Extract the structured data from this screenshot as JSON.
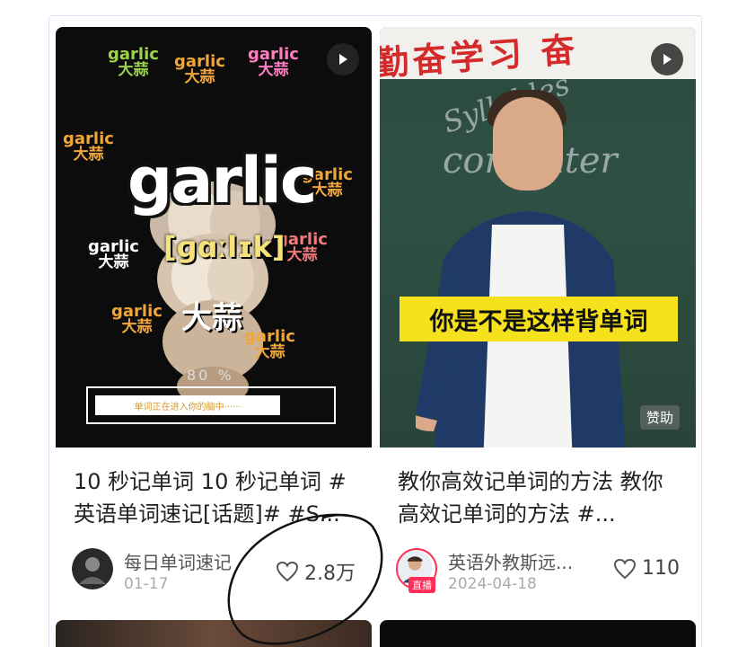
{
  "cards": [
    {
      "title": "10 秒记单词 10 秒记单词 #英语单词速记[话题]# #S...",
      "author": "每日单词速记",
      "date": "01-17",
      "likes": "2.8万",
      "thumb": {
        "word": "garlic",
        "phonetic": "[ɡɑːlɪk]",
        "meaning": "大蒜",
        "small_en": "garlic",
        "small_cn": "大蒜",
        "progress_text": "80 %",
        "progress": 0.8,
        "loading_text": "单词正在进入你的脑中······"
      }
    },
    {
      "title": "教你高效记单词的方法 教你高效记单词的方法 #...",
      "author": "英语外教斯远...",
      "date": "2024-04-18",
      "likes": "110",
      "live_badge": "直播",
      "thumb": {
        "banner": "勤奋学习 奋",
        "chalk_1": "Syllables",
        "chalk_2": "computer",
        "caption": "你是不是这样背单词",
        "sponsor": "赞助"
      }
    }
  ],
  "colors": {
    "accent_red": "#ff2d55",
    "caption_yellow": "#f5e21d",
    "garlic_yellow": "#f5e27a"
  }
}
